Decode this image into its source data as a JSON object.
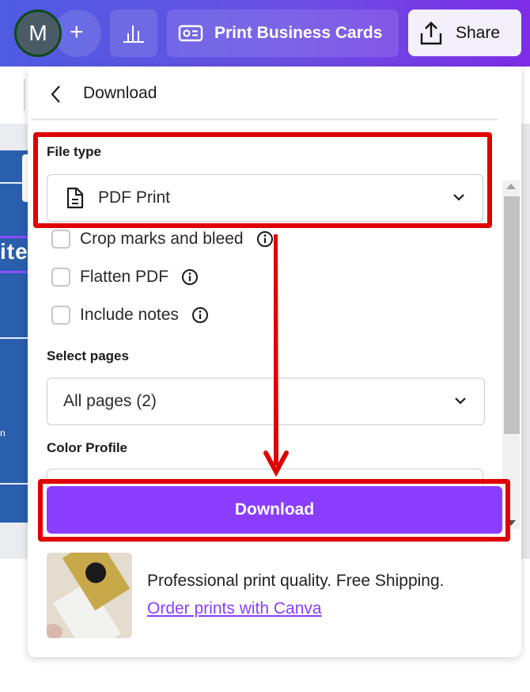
{
  "topbar": {
    "avatar_initial": "M",
    "add_icon": "plus-icon",
    "insights_icon": "bar-chart-icon",
    "print_button": {
      "icon": "business-card-icon",
      "label": "Print Business Cards"
    },
    "share_button": {
      "icon": "upload-share-icon",
      "label": "Share"
    }
  },
  "panel": {
    "back_icon": "chevron-left-icon",
    "title": "Download",
    "file_type": {
      "label": "File type",
      "icon": "document-icon",
      "value": "PDF Print"
    },
    "options": [
      {
        "label": "Crop marks and bleed",
        "checked": false,
        "info_icon": "info-icon"
      },
      {
        "label": "Flatten PDF",
        "checked": false,
        "info_icon": "info-icon"
      },
      {
        "label": "Include notes",
        "checked": false,
        "info_icon": "info-icon"
      }
    ],
    "select_pages": {
      "label": "Select pages",
      "value": "All pages (2)"
    },
    "color_profile": {
      "label": "Color Profile",
      "value": ""
    },
    "download_button": "Download",
    "promo": {
      "text": "Professional print quality. Free Shipping.",
      "link": "Order prints with Canva"
    }
  },
  "background": {
    "design_text": "ite",
    "design_small_text": "n"
  },
  "colors": {
    "brand_purple": "#8b3dff",
    "annotation_red": "#e00000",
    "topbar_start": "#4f5be0",
    "topbar_end": "#7d2ee6"
  }
}
